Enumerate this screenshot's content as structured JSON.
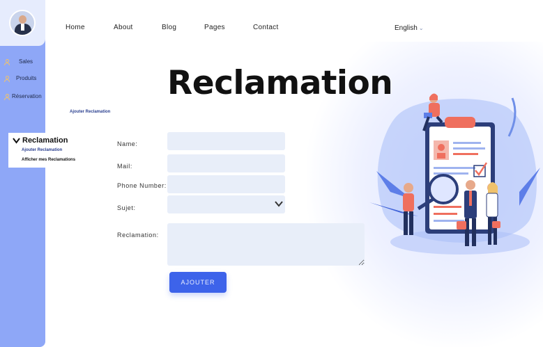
{
  "sidebar": {
    "items": [
      {
        "label": "Sales"
      },
      {
        "label": "Produits"
      },
      {
        "label": "Réservation"
      }
    ],
    "submenu": {
      "title": "Reclamation",
      "links": [
        "Ajouter Reclamation",
        "Afficher mes Reclamations"
      ]
    }
  },
  "nav": {
    "items": [
      "Home",
      "About",
      "Blog",
      "Pages",
      "Contact"
    ],
    "language": "English"
  },
  "page": {
    "title": "Reclamation",
    "breadcrumb": "Ajouter Reclamation"
  },
  "form": {
    "name_label": "Name:",
    "mail_label": "Mail:",
    "phone_label": "Phone Number:",
    "subject_label": "Sujet:",
    "reclamation_label": "Reclamation:",
    "submit_label": "AJOUTER"
  },
  "icons": {
    "chevron": "chevron-down-icon",
    "user": "user-icon"
  },
  "colors": {
    "sidebar": "#8ea7f7",
    "accent": "#3d63ea",
    "input_bg": "#e8eef9"
  }
}
